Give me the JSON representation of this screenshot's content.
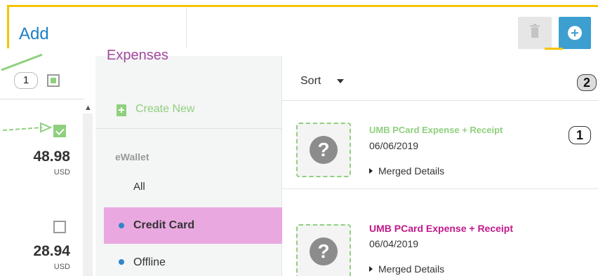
{
  "header": {
    "title": "Add",
    "delete_icon": "trash-icon",
    "add_icon": "plus-circle-icon"
  },
  "left_list": {
    "step_badge": "1",
    "rows": [
      {
        "amount": "48.98",
        "currency": "USD",
        "checked": true
      },
      {
        "amount": "28.94",
        "currency": "USD",
        "checked": false
      }
    ]
  },
  "categories": {
    "title": "Expenses",
    "create_new": "Create New",
    "group_label": "eWallet",
    "all": "All",
    "credit_card": "Credit Card",
    "offline": "Offline"
  },
  "main": {
    "sort_label": "Sort",
    "step_badge_sort": "2",
    "step_badge_item": "1",
    "items": [
      {
        "title": "UMB PCard Expense + Receipt",
        "date": "06/06/2019",
        "merged": "Merged Details"
      },
      {
        "title": "UMB PCard Expense + Receipt",
        "date": "06/04/2019",
        "merged": "Merged Details"
      }
    ]
  },
  "colors": {
    "accent_blue": "#3d9fcf",
    "title_blue": "#1d7fc4",
    "magenta": "#c2188b",
    "highlight_pink": "#e9a8e0",
    "green": "#8fd07e",
    "frame_yellow": "#f5c400"
  }
}
